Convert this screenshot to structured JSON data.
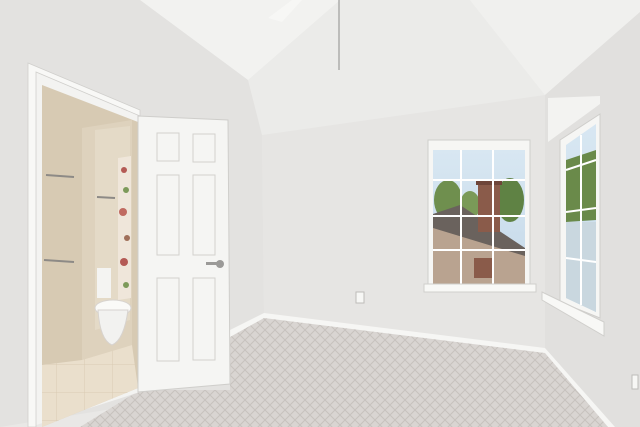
{
  "scene": {
    "colors": {
      "wall": "#e6e5e3",
      "ceiling": "#efefed",
      "trim": "#f4f4f2",
      "carpet": "#d6d2cf",
      "bath_wall": "#d9cdb8",
      "bath_tile": "#e8dcc7",
      "sky": "#cfe0ee",
      "foliage": "#6f8f4e",
      "brick": "#8a5b4a"
    },
    "objects": [
      "vaulted-ceiling",
      "ceiling-fan",
      "six-panel-door",
      "bathroom-doorway",
      "toilet",
      "shower-curtain",
      "window-back-wall",
      "window-right-wall",
      "carpet-floor",
      "baseboard",
      "wall-outlet"
    ]
  }
}
